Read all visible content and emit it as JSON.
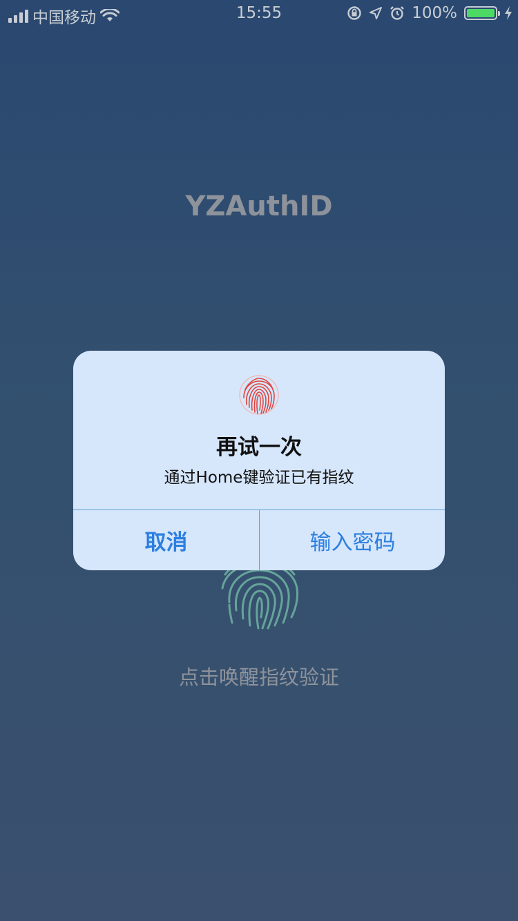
{
  "status_bar": {
    "carrier": "中国移动",
    "time": "15:55",
    "battery_percent": "100%",
    "icons": [
      "signal-icon",
      "wifi-icon",
      "orientation-lock-icon",
      "location-icon",
      "alarm-icon",
      "battery-icon",
      "charging-icon"
    ]
  },
  "app": {
    "title": "YZAuthID",
    "hint": "点击唤醒指纹验证"
  },
  "alert": {
    "title": "再试一次",
    "message": "通过Home键验证已有指纹",
    "cancel_label": "取消",
    "password_label": "输入密码"
  },
  "colors": {
    "background_top": "#2a4870",
    "background_bottom": "#3a506e",
    "alert_background": "#d6e6fb",
    "button_text": "#2b7fe0",
    "fingerprint_alert": "#e0443f",
    "fingerprint_background": "#6fb3a2"
  }
}
